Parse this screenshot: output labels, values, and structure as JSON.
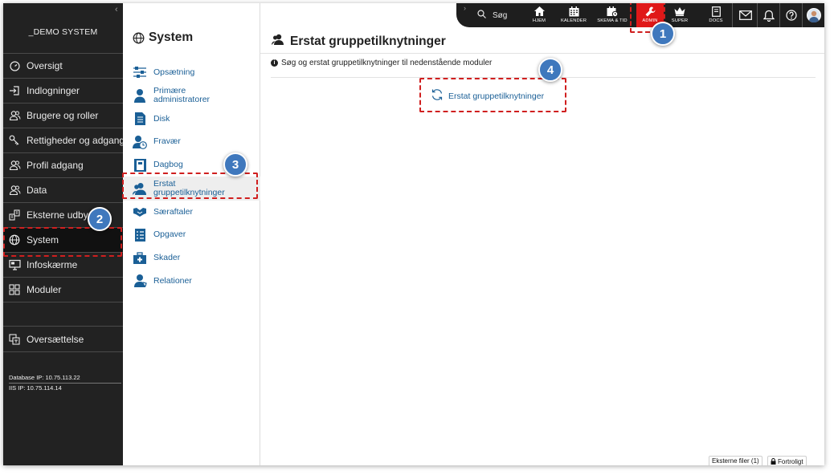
{
  "sidebar": {
    "brand": "_DEMO SYSTEM",
    "items": [
      {
        "label": "Oversigt",
        "icon": "dashboard-icon"
      },
      {
        "label": "Indlogninger",
        "icon": "login-icon"
      },
      {
        "label": "Brugere og roller",
        "icon": "users-icon"
      },
      {
        "label": "Rettigheder og adgang",
        "icon": "key-icon"
      },
      {
        "label": "Profil adgang",
        "icon": "profile-users-icon"
      },
      {
        "label": "Data",
        "icon": "data-users-icon"
      },
      {
        "label": "Eksterne udbydere",
        "icon": "external-providers-icon"
      },
      {
        "label": "System",
        "icon": "globe-icon"
      },
      {
        "label": "Infoskærme",
        "icon": "monitor-icon"
      },
      {
        "label": "Moduler",
        "icon": "modules-icon"
      },
      {
        "label": "Oversættelse",
        "icon": "translate-icon"
      }
    ],
    "db_ip": "Database IP: 10.75.113.22",
    "iis_ip": "IIS IP: 10.75.114.14"
  },
  "subnav": {
    "title": "System",
    "items": [
      {
        "label": "Opsætning",
        "icon": "sliders-icon"
      },
      {
        "label": "Primære administratorer",
        "icon": "person-icon"
      },
      {
        "label": "Disk",
        "icon": "document-icon"
      },
      {
        "label": "Fravær",
        "icon": "absence-icon"
      },
      {
        "label": "Dagbog",
        "icon": "diary-icon"
      },
      {
        "label": "Erstat gruppetilknytninger",
        "icon": "person-group-icon"
      },
      {
        "label": "Særaftaler",
        "icon": "handshake-icon"
      },
      {
        "label": "Opgaver",
        "icon": "tasks-icon"
      },
      {
        "label": "Skader",
        "icon": "first-aid-icon"
      },
      {
        "label": "Relationer",
        "icon": "relations-icon"
      }
    ]
  },
  "topbar": {
    "search_label": "Søg",
    "buttons": [
      {
        "label": "HJEM",
        "icon": "home-icon"
      },
      {
        "label": "KALENDER",
        "icon": "calendar-icon"
      },
      {
        "label": "SKEMA & TID",
        "icon": "schedule-icon"
      },
      {
        "label": "ADMIN",
        "icon": "wrench-icon"
      },
      {
        "label": "SUPER",
        "icon": "crown-icon"
      },
      {
        "label": "DOCS",
        "icon": "docs-icon"
      }
    ]
  },
  "main": {
    "title": "Erstat gruppetilknytninger",
    "info": "Søg og erstat gruppetilknytninger til nedenstående moduler",
    "link": "Erstat gruppetilknytninger"
  },
  "footer": {
    "external_files": "Eksterne filer (1)",
    "confidential": "Fortroligt"
  },
  "badges": [
    "1",
    "2",
    "3",
    "4"
  ],
  "colors": {
    "sidebar_bg": "#222222",
    "link_blue": "#1a5f96",
    "admin_red": "#e01818",
    "highlight_red": "#d01f1f",
    "badge_blue": "#3f78bd"
  }
}
